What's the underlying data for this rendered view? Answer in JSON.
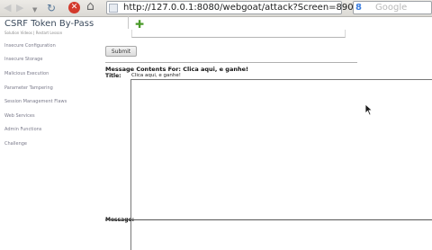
{
  "browser": {
    "url": "http://127.0.0.1:8080/webgoat/attack?Screen=890...",
    "search_placeholder": "Google",
    "search_engine_glyph": "8"
  },
  "page": {
    "title": "CSRF Token By-Pass",
    "subtitle_caption": "Solution Videos | Restart Lesson"
  },
  "sidebar": {
    "items": [
      {
        "label": "Insecure Configuration"
      },
      {
        "label": "Insecure Storage"
      },
      {
        "label": "Malicious Execution"
      },
      {
        "label": "Parameter Tampering"
      },
      {
        "label": "Session Management Flaws"
      },
      {
        "label": "Web Services"
      },
      {
        "label": "Admin Functions"
      },
      {
        "label": "Challenge"
      }
    ]
  },
  "form": {
    "submit_label": "Submit",
    "message_header": "Message Contents For: Clica aqui, e ganhe!",
    "title_label": "Title:",
    "title_value": "Clica aqui, e ganhe!",
    "message_label": "Message:"
  },
  "colors": {
    "stop_button": "#d33a2c",
    "addon_green": "#4a9a2a",
    "page_title": "#3b4a5c"
  },
  "icons": {
    "back": "back-arrow-icon",
    "forward": "forward-arrow-icon",
    "reload": "reload-icon",
    "stop": "stop-icon",
    "home": "home-icon",
    "bookmark": "star-icon",
    "addon": "puzzle-piece-icon",
    "cursor": "mouse-pointer-icon"
  }
}
